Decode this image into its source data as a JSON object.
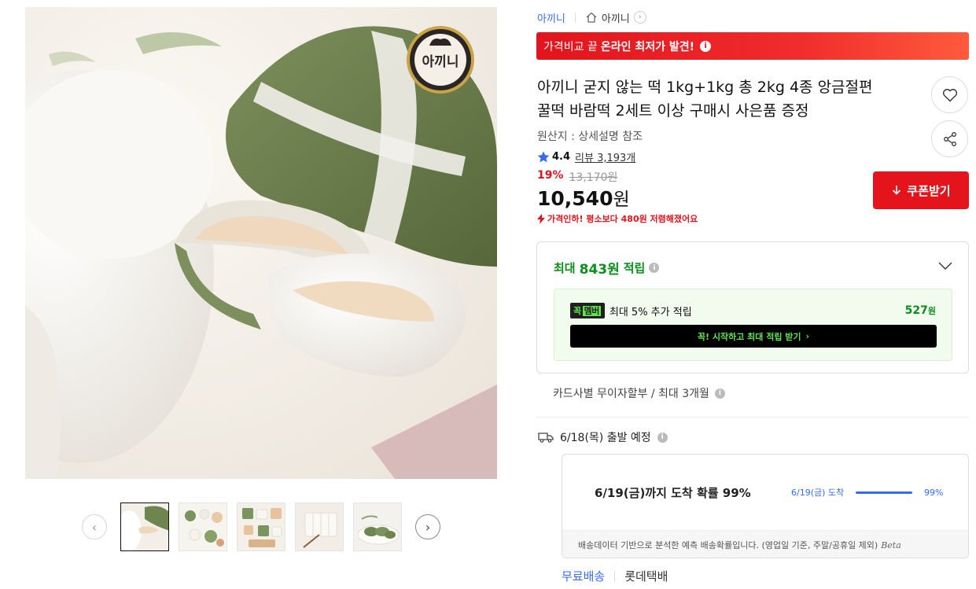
{
  "brand_logo_text": "아끼니",
  "breadcrumb": {
    "brand": "아끼니",
    "store": "아끼니"
  },
  "promo_banner": {
    "prefix": "가격비교 끝",
    "highlight": "온라인 최저가 발견!"
  },
  "product": {
    "title_line1": "아끼니 굳지 않는 떡 1kg+1kg 총 2kg 4종 앙금절편",
    "title_line2": "꿀떡 바람떡 2세트 이상 구매시 사은품 증정",
    "origin": "원산지 : 상세설명 참조",
    "rating": "4.4",
    "review_text": "리뷰 3,193개",
    "discount": "19%",
    "original_price": "13,170원",
    "price_number": "10,540",
    "price_unit": "원",
    "price_drop_notice": "가격인하! 평소보다 480원 저렴해졌어요"
  },
  "actions": {
    "coupon_label": "쿠폰받기"
  },
  "reward": {
    "prefix": "최대",
    "amount": "843원",
    "suffix": "적립",
    "member_badge_a": "꼭",
    "member_badge_b": "멤버",
    "member_text": "최대 5% 추가 적립",
    "member_points": "527",
    "member_points_unit": "원",
    "member_cta": "꼭! 시작하고 최대 적립 받기"
  },
  "installment": "카드사별 무이자할부 / 최대 3개월",
  "shipping": {
    "departure": "6/18(목) 출발 예정",
    "arrival_headline": "6/19(금)까지 도착 확률 99%",
    "arrival_date": "6/19(금) 도착",
    "arrival_prob": 0.99,
    "arrival_pct_text": "99%",
    "footnote": "배송데이터 기반으로 분석한 예측 배송확률입니다. (영업일 기준, 주말/공휴일 제외)",
    "beta": "Beta",
    "free_shipping": "무료배송",
    "courier": "롯데택배"
  },
  "colors": {
    "accent_red": "#e3141c",
    "accent_blue": "#346aff",
    "reward_green": "#0a8f1b",
    "member_lime": "#5fe64d"
  }
}
